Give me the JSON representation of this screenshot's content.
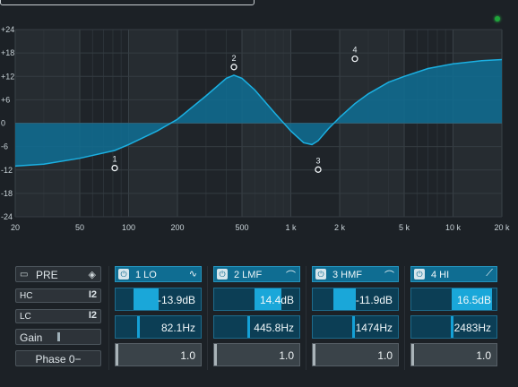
{
  "eq": {
    "y_ticks": [
      "+24",
      "+18",
      "+12",
      "+6",
      "0",
      "-6",
      "-12",
      "-18",
      "-24"
    ],
    "x_ticks": [
      "20",
      "50",
      "100",
      "200",
      "500",
      "1 k",
      "2 k",
      "5 k",
      "10 k",
      "20 k"
    ],
    "band_points": [
      "1",
      "2",
      "3",
      "4"
    ],
    "curve_color": "#1496c8",
    "status_led_color": "#1fa53a"
  },
  "pre": {
    "title": "PRE",
    "hc_label": "HC",
    "lc_label": "LC",
    "filter_icon": "I2",
    "gain_label": "Gain",
    "phase_label": "Phase 0−"
  },
  "bands": [
    {
      "name": "1 LO",
      "gain": "-13.9dB",
      "freq": "82.1Hz",
      "q": "1.0",
      "shape": "low-shelf-icon"
    },
    {
      "name": "2 LMF",
      "gain": "14.4dB",
      "freq": "445.8Hz",
      "q": "1.0",
      "shape": "peak-icon"
    },
    {
      "name": "3 HMF",
      "gain": "-11.9dB",
      "freq": "1474Hz",
      "q": "1.0",
      "shape": "peak-icon"
    },
    {
      "name": "4 HI",
      "gain": "16.5dB",
      "freq": "2483Hz",
      "q": "1.0",
      "shape": "high-shelf-icon"
    }
  ]
}
